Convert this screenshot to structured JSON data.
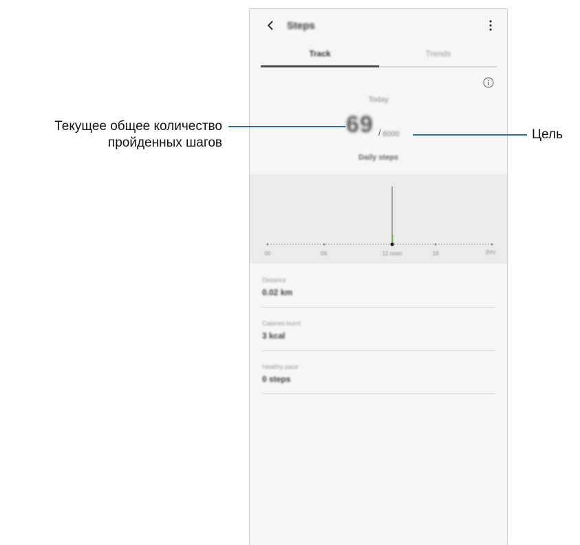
{
  "app": {
    "title": "Steps",
    "tabs": [
      "Track",
      "Trends"
    ],
    "today_label": "Today",
    "steps_count": "69",
    "goal": "6000",
    "daily_label": "Daily steps"
  },
  "chart": {
    "x_labels": [
      "00",
      "06",
      "12 noon",
      "18",
      "(hh)"
    ]
  },
  "stats": [
    {
      "label": "Distance",
      "value": "0.02 km"
    },
    {
      "label": "Calories burnt",
      "value": "3 kcal"
    },
    {
      "label": "Healthy pace",
      "value": "0 steps"
    }
  ],
  "callouts": {
    "current_total_line1": "Текущее общее количество",
    "current_total_line2": "пройденных шагов",
    "goal": "Цель"
  },
  "colors": {
    "callout": "#2b6f95",
    "bar": "#6cc04a",
    "panel": "#f6f6f6"
  }
}
